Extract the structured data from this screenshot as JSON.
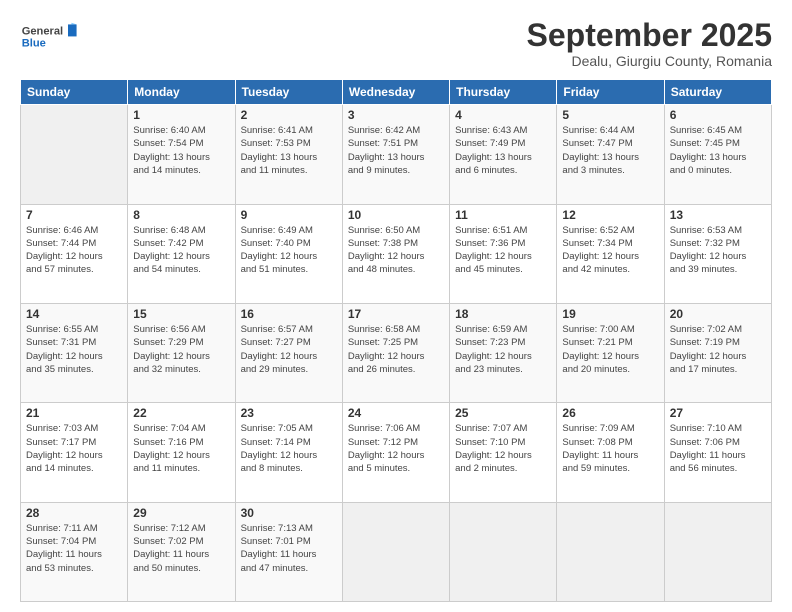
{
  "header": {
    "logo_general": "General",
    "logo_blue": "Blue",
    "title": "September 2025",
    "subtitle": "Dealu, Giurgiu County, Romania"
  },
  "weekdays": [
    "Sunday",
    "Monday",
    "Tuesday",
    "Wednesday",
    "Thursday",
    "Friday",
    "Saturday"
  ],
  "weeks": [
    [
      {
        "day": "",
        "info": ""
      },
      {
        "day": "1",
        "info": "Sunrise: 6:40 AM\nSunset: 7:54 PM\nDaylight: 13 hours\nand 14 minutes."
      },
      {
        "day": "2",
        "info": "Sunrise: 6:41 AM\nSunset: 7:53 PM\nDaylight: 13 hours\nand 11 minutes."
      },
      {
        "day": "3",
        "info": "Sunrise: 6:42 AM\nSunset: 7:51 PM\nDaylight: 13 hours\nand 9 minutes."
      },
      {
        "day": "4",
        "info": "Sunrise: 6:43 AM\nSunset: 7:49 PM\nDaylight: 13 hours\nand 6 minutes."
      },
      {
        "day": "5",
        "info": "Sunrise: 6:44 AM\nSunset: 7:47 PM\nDaylight: 13 hours\nand 3 minutes."
      },
      {
        "day": "6",
        "info": "Sunrise: 6:45 AM\nSunset: 7:45 PM\nDaylight: 13 hours\nand 0 minutes."
      }
    ],
    [
      {
        "day": "7",
        "info": "Sunrise: 6:46 AM\nSunset: 7:44 PM\nDaylight: 12 hours\nand 57 minutes."
      },
      {
        "day": "8",
        "info": "Sunrise: 6:48 AM\nSunset: 7:42 PM\nDaylight: 12 hours\nand 54 minutes."
      },
      {
        "day": "9",
        "info": "Sunrise: 6:49 AM\nSunset: 7:40 PM\nDaylight: 12 hours\nand 51 minutes."
      },
      {
        "day": "10",
        "info": "Sunrise: 6:50 AM\nSunset: 7:38 PM\nDaylight: 12 hours\nand 48 minutes."
      },
      {
        "day": "11",
        "info": "Sunrise: 6:51 AM\nSunset: 7:36 PM\nDaylight: 12 hours\nand 45 minutes."
      },
      {
        "day": "12",
        "info": "Sunrise: 6:52 AM\nSunset: 7:34 PM\nDaylight: 12 hours\nand 42 minutes."
      },
      {
        "day": "13",
        "info": "Sunrise: 6:53 AM\nSunset: 7:32 PM\nDaylight: 12 hours\nand 39 minutes."
      }
    ],
    [
      {
        "day": "14",
        "info": "Sunrise: 6:55 AM\nSunset: 7:31 PM\nDaylight: 12 hours\nand 35 minutes."
      },
      {
        "day": "15",
        "info": "Sunrise: 6:56 AM\nSunset: 7:29 PM\nDaylight: 12 hours\nand 32 minutes."
      },
      {
        "day": "16",
        "info": "Sunrise: 6:57 AM\nSunset: 7:27 PM\nDaylight: 12 hours\nand 29 minutes."
      },
      {
        "day": "17",
        "info": "Sunrise: 6:58 AM\nSunset: 7:25 PM\nDaylight: 12 hours\nand 26 minutes."
      },
      {
        "day": "18",
        "info": "Sunrise: 6:59 AM\nSunset: 7:23 PM\nDaylight: 12 hours\nand 23 minutes."
      },
      {
        "day": "19",
        "info": "Sunrise: 7:00 AM\nSunset: 7:21 PM\nDaylight: 12 hours\nand 20 minutes."
      },
      {
        "day": "20",
        "info": "Sunrise: 7:02 AM\nSunset: 7:19 PM\nDaylight: 12 hours\nand 17 minutes."
      }
    ],
    [
      {
        "day": "21",
        "info": "Sunrise: 7:03 AM\nSunset: 7:17 PM\nDaylight: 12 hours\nand 14 minutes."
      },
      {
        "day": "22",
        "info": "Sunrise: 7:04 AM\nSunset: 7:16 PM\nDaylight: 12 hours\nand 11 minutes."
      },
      {
        "day": "23",
        "info": "Sunrise: 7:05 AM\nSunset: 7:14 PM\nDaylight: 12 hours\nand 8 minutes."
      },
      {
        "day": "24",
        "info": "Sunrise: 7:06 AM\nSunset: 7:12 PM\nDaylight: 12 hours\nand 5 minutes."
      },
      {
        "day": "25",
        "info": "Sunrise: 7:07 AM\nSunset: 7:10 PM\nDaylight: 12 hours\nand 2 minutes."
      },
      {
        "day": "26",
        "info": "Sunrise: 7:09 AM\nSunset: 7:08 PM\nDaylight: 11 hours\nand 59 minutes."
      },
      {
        "day": "27",
        "info": "Sunrise: 7:10 AM\nSunset: 7:06 PM\nDaylight: 11 hours\nand 56 minutes."
      }
    ],
    [
      {
        "day": "28",
        "info": "Sunrise: 7:11 AM\nSunset: 7:04 PM\nDaylight: 11 hours\nand 53 minutes."
      },
      {
        "day": "29",
        "info": "Sunrise: 7:12 AM\nSunset: 7:02 PM\nDaylight: 11 hours\nand 50 minutes."
      },
      {
        "day": "30",
        "info": "Sunrise: 7:13 AM\nSunset: 7:01 PM\nDaylight: 11 hours\nand 47 minutes."
      },
      {
        "day": "",
        "info": ""
      },
      {
        "day": "",
        "info": ""
      },
      {
        "day": "",
        "info": ""
      },
      {
        "day": "",
        "info": ""
      }
    ]
  ]
}
